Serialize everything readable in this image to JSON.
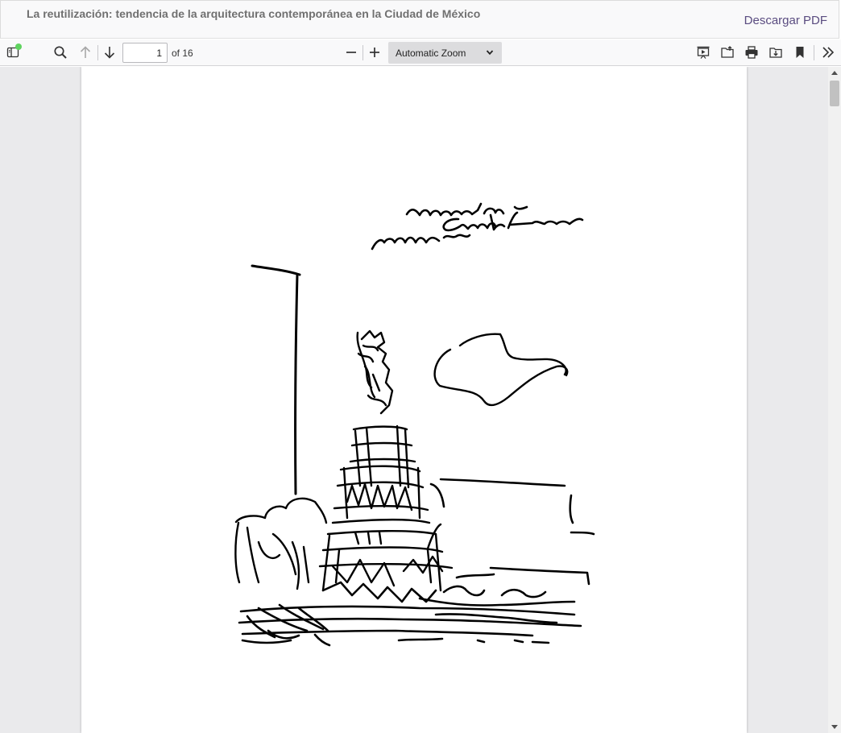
{
  "header": {
    "title": "La reutilización: tendencia de la arquitectura contemporánea en la Ciudad de México",
    "download_label": "Descargar PDF"
  },
  "toolbar": {
    "page_current": "1",
    "page_total_label": "of 16",
    "zoom_selected": "Automatic Zoom",
    "icons": [
      "sidebar-toggle-icon",
      "search-icon",
      "previous-page-icon",
      "next-page-icon",
      "zoom-out-icon",
      "zoom-in-icon",
      "presentation-mode-icon",
      "open-file-icon",
      "print-icon",
      "download-icon",
      "bookmark-icon",
      "tools-icon"
    ]
  },
  "document": {
    "sketch_caption_handwritten": "monumento a Cuauhtémoc México"
  },
  "colors": {
    "accent_link": "#5a4c80",
    "notification_dot": "#5fd35f",
    "viewer_background": "#eaeaec"
  }
}
